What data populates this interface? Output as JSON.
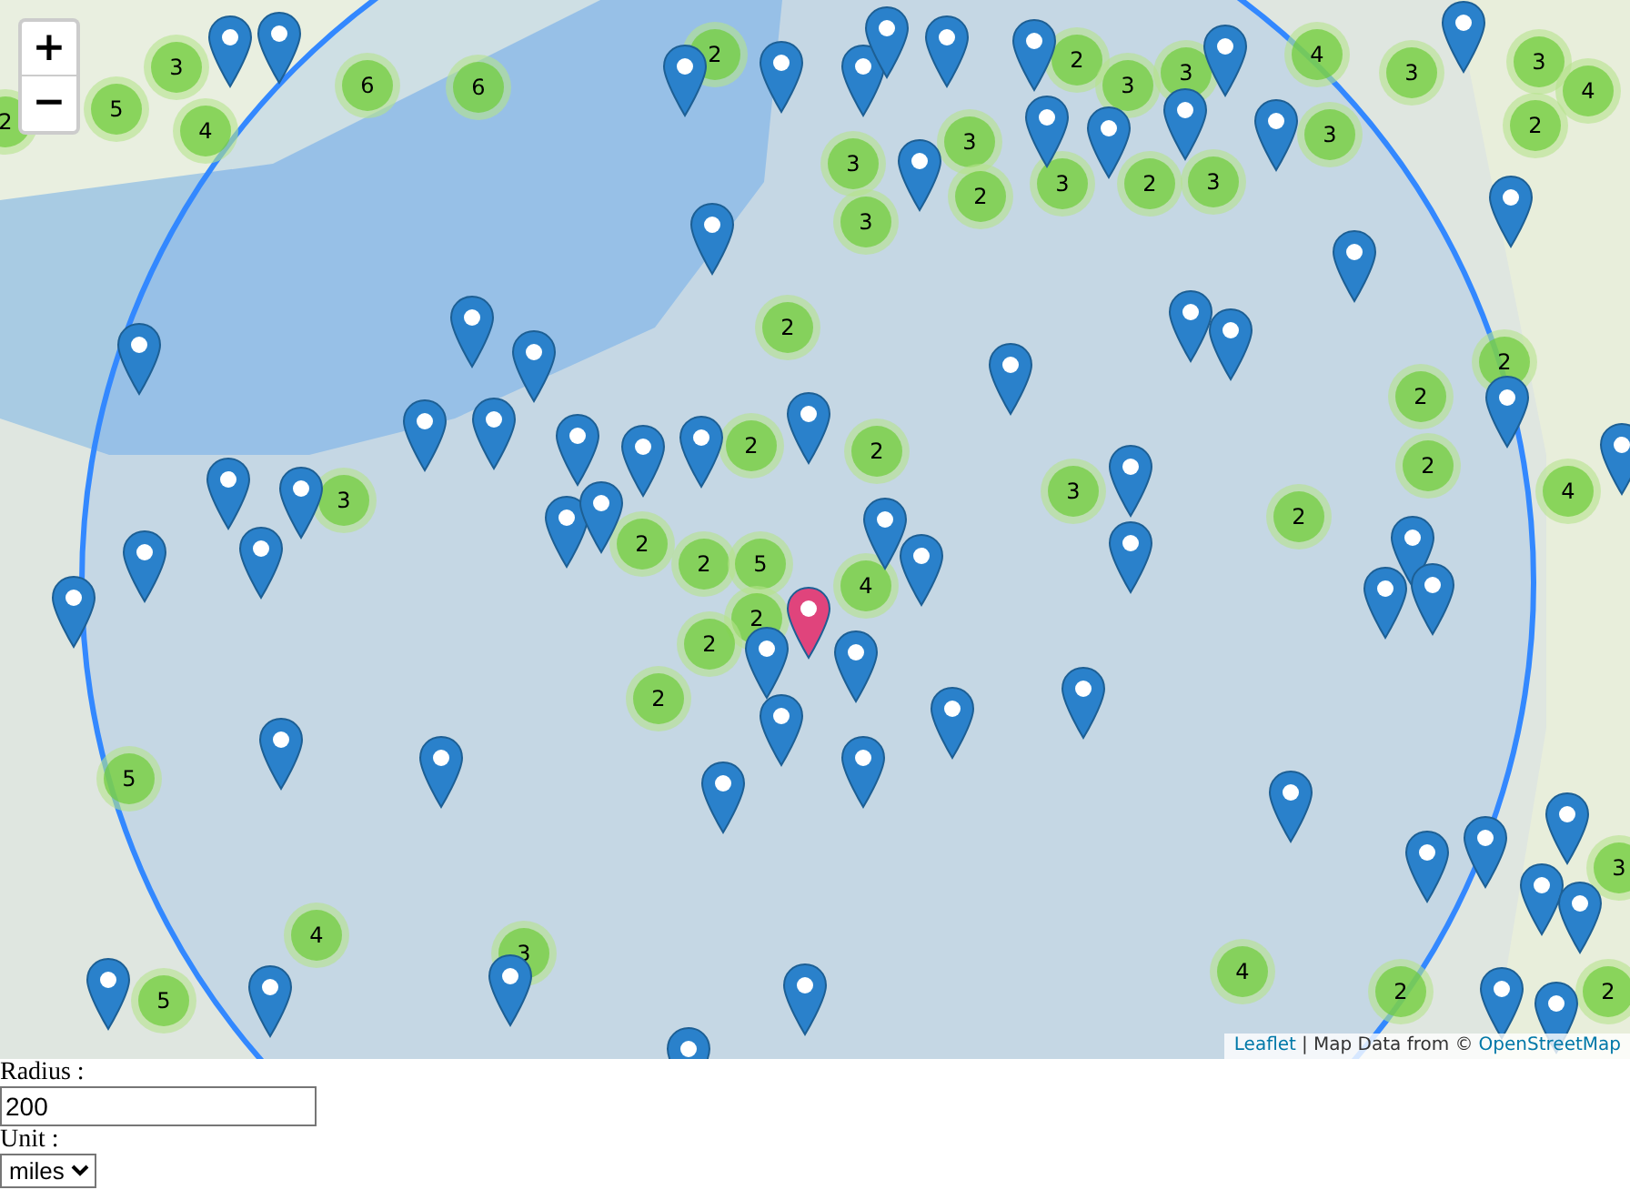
{
  "map": {
    "zoom_in": "+",
    "zoom_out": "−",
    "clusters": [
      {
        "count": "3"
      },
      {
        "count": "6"
      },
      {
        "count": "6"
      },
      {
        "count": "5"
      },
      {
        "count": "2"
      },
      {
        "count": "4"
      },
      {
        "count": "2"
      },
      {
        "count": "2"
      },
      {
        "count": "3"
      },
      {
        "count": "3"
      },
      {
        "count": "4"
      },
      {
        "count": "3"
      },
      {
        "count": "3"
      },
      {
        "count": "4"
      },
      {
        "count": "3"
      },
      {
        "count": "2"
      },
      {
        "count": "3"
      },
      {
        "count": "3"
      },
      {
        "count": "2"
      },
      {
        "count": "3"
      },
      {
        "count": "2"
      },
      {
        "count": "3"
      },
      {
        "count": "3"
      },
      {
        "count": "2"
      },
      {
        "count": "2"
      },
      {
        "count": "2"
      },
      {
        "count": "3"
      },
      {
        "count": "2"
      },
      {
        "count": "2"
      },
      {
        "count": "2"
      },
      {
        "count": "2"
      },
      {
        "count": "4"
      },
      {
        "count": "3"
      },
      {
        "count": "2"
      },
      {
        "count": "2"
      },
      {
        "count": "5"
      },
      {
        "count": "2"
      },
      {
        "count": "2"
      },
      {
        "count": "4"
      },
      {
        "count": "2"
      },
      {
        "count": "5"
      },
      {
        "count": "4"
      },
      {
        "count": "5"
      },
      {
        "count": "3"
      },
      {
        "count": "4"
      },
      {
        "count": "2"
      },
      {
        "count": "2"
      },
      {
        "count": "3"
      }
    ],
    "attribution": {
      "link": "Leaflet",
      "text": "| Map Data from ©",
      "source": "OpenStreetMap"
    }
  },
  "form": {
    "radius_label": "Radius :",
    "radius_value": "200",
    "unit_label": "Unit :",
    "unit_value": "miles"
  }
}
